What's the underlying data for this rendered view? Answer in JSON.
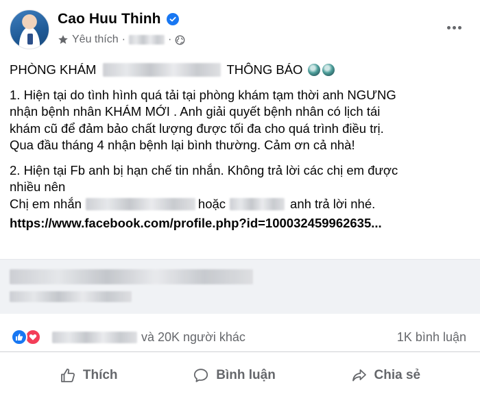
{
  "post": {
    "author_name": "Cao Huu Thinh",
    "meta_label": "Yêu thích",
    "meta_separator": "·"
  },
  "content": {
    "headline_prefix": "PHÒNG KHÁM",
    "headline_suffix": "THÔNG BÁO",
    "p1_lines": [
      "1. Hiện tại do tình hình quá tải tại phòng khám tạm thời anh NGƯNG",
      "nhận bệnh nhân KHÁM MỚI . Anh giải quyết bệnh nhân có lịch tái",
      "khám cũ để đảm bảo chất lượng được tối đa cho quá trình điều trị.",
      "Qua đầu tháng 4 nhận bệnh lại bình thường. Cảm ơn cả nhà!"
    ],
    "p2_lines": [
      "2. Hiện tại Fb anh bị hạn chế tin nhắn. Không trả lời các chị em được",
      "nhiều nên"
    ],
    "p2_contact_prefix": "Chị em nhắn",
    "p2_contact_or": "hoặc",
    "p2_contact_suffix": "anh trả lời nhé.",
    "link": "https://www.facebook.com/profile.php?id=100032459962635..."
  },
  "reactions": {
    "count_text": "và 20K người khác",
    "comments_text": "1K bình luận"
  },
  "actions": {
    "like": "Thích",
    "comment": "Bình luận",
    "share": "Chia sẻ"
  }
}
